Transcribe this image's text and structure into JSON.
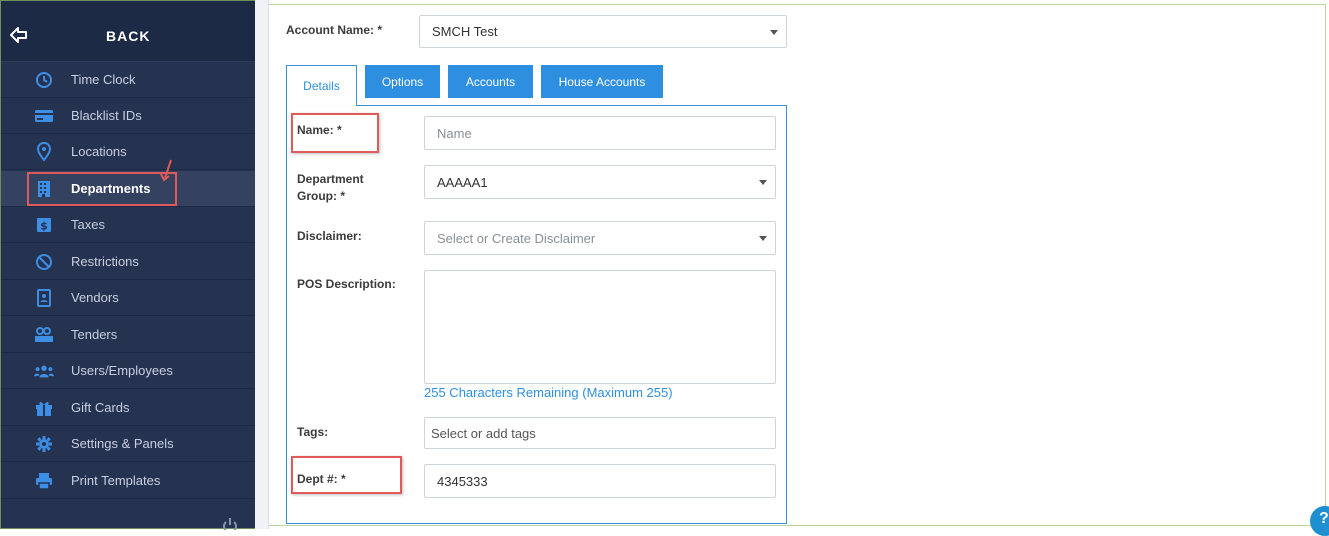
{
  "sidebar": {
    "back_label": "BACK",
    "items": [
      {
        "label": "Time Clock",
        "icon": "clock-icon"
      },
      {
        "label": "Blacklist IDs",
        "icon": "id-card-icon"
      },
      {
        "label": "Locations",
        "icon": "location-pin-icon"
      },
      {
        "label": "Departments",
        "icon": "building-icon",
        "active": true
      },
      {
        "label": "Taxes",
        "icon": "dollar-icon"
      },
      {
        "label": "Restrictions",
        "icon": "ban-icon"
      },
      {
        "label": "Vendors",
        "icon": "contact-book-icon"
      },
      {
        "label": "Tenders",
        "icon": "money-icon"
      },
      {
        "label": "Users/Employees",
        "icon": "users-icon"
      },
      {
        "label": "Gift Cards",
        "icon": "gift-icon"
      },
      {
        "label": "Settings & Panels",
        "icon": "gear-icon"
      },
      {
        "label": "Print Templates",
        "icon": "printer-icon"
      }
    ]
  },
  "account": {
    "label": "Account Name: *",
    "value": "SMCH Test"
  },
  "tabs": [
    {
      "label": "Details",
      "active": true
    },
    {
      "label": "Options"
    },
    {
      "label": "Accounts"
    },
    {
      "label": "House Accounts"
    }
  ],
  "form": {
    "name_label": "Name: *",
    "name_placeholder": "Name",
    "dept_group_label_1": "Department",
    "dept_group_label_2": "Group: *",
    "dept_group_value": "AAAAA1",
    "disclaimer_label": "Disclaimer:",
    "disclaimer_placeholder": "Select or Create Disclaimer",
    "pos_label": "POS Description:",
    "pos_remaining": "255 Characters Remaining (Maximum 255)",
    "tags_label": "Tags:",
    "tags_placeholder": "Select or add tags",
    "dept_num_label": "Dept #: *",
    "dept_num_value": "4345333"
  },
  "colors": {
    "sidebar_bg": "#253250",
    "accent_blue": "#2e8fe0",
    "icon_blue": "#3d8fe6",
    "highlight_red": "#e05a5a"
  }
}
